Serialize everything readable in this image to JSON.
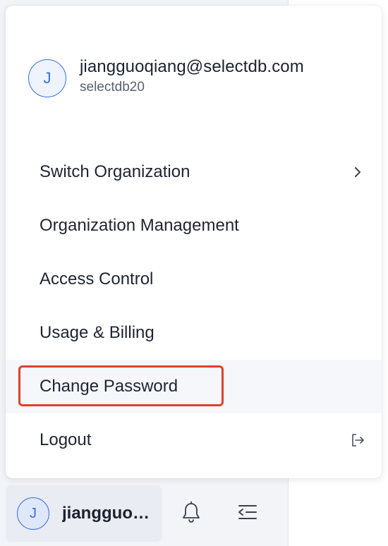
{
  "user": {
    "avatar_initial": "J",
    "email": "jiangguoqiang@selectdb.com",
    "org": "selectdb20"
  },
  "menu": {
    "items": [
      {
        "label": "Switch Organization",
        "trail_icon": "chevron-right-icon"
      },
      {
        "label": "Organization Management"
      },
      {
        "label": "Access Control"
      },
      {
        "label": "Usage & Billing"
      },
      {
        "label": "Change Password",
        "highlighted": true
      },
      {
        "label": "Logout",
        "trail_icon": "logout-icon"
      }
    ]
  },
  "bottom_bar": {
    "avatar_initial": "J",
    "username": "jiangguoqiang@selectdb.com",
    "icons": [
      "bell-icon",
      "collapse-menu-icon"
    ]
  },
  "colors": {
    "accent": "#3b6fe0",
    "highlight_border": "#e0402b",
    "hover_bg": "#f5f7fb"
  }
}
